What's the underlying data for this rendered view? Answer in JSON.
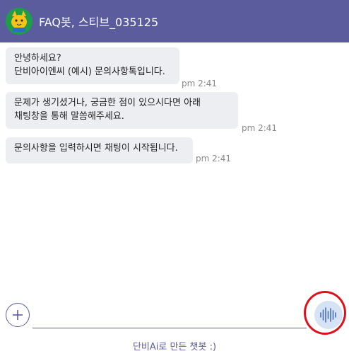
{
  "header": {
    "title": "FAQ봇, 스티브_035125",
    "background": "#5a5c9e"
  },
  "messages": [
    {
      "lines": [
        "안녕하세요?",
        "단비아이엔씨 (예시) 문의사항톡입니다."
      ],
      "time": "pm 2:41"
    },
    {
      "lines": [
        "문제가 생기셨거나, 궁금한 점이 있으시다면 아래",
        "채팅창을 통해 말씀해주세요."
      ],
      "time": "pm 2:41"
    },
    {
      "lines": [
        "문의사항을 입력하시면 채팅이 시작됩니다."
      ],
      "time": "pm 2:41"
    }
  ],
  "input": {
    "add_icon": "plus-icon",
    "voice_icon": "voice-wave-icon"
  },
  "footer": {
    "text": "단비Ai로 만든 챗봇 :)"
  },
  "annotation": {
    "color": "#e0101a"
  }
}
